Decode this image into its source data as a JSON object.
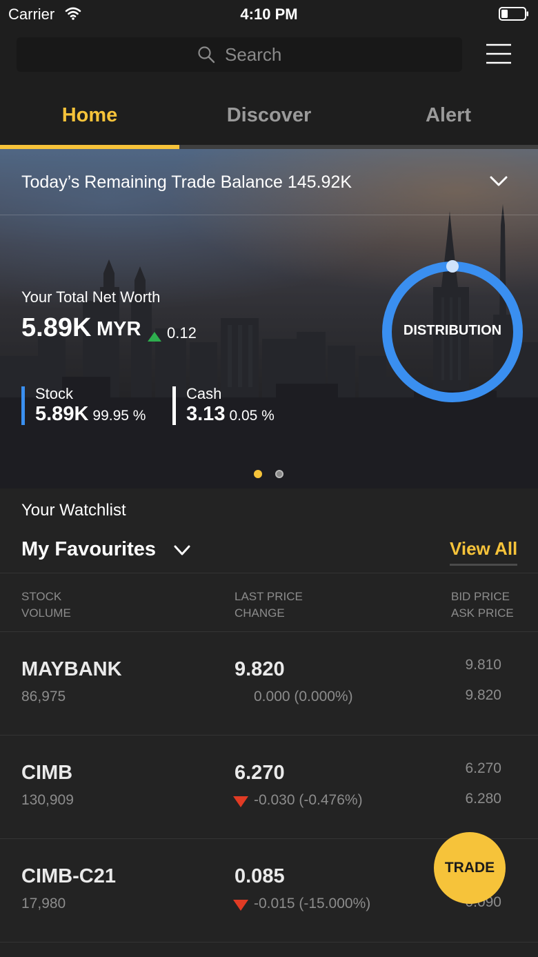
{
  "status_bar": {
    "carrier": "Carrier",
    "time": "4:10 PM"
  },
  "search": {
    "placeholder": "Search"
  },
  "tabs": [
    {
      "label": "Home",
      "active": true
    },
    {
      "label": "Discover",
      "active": false
    },
    {
      "label": "Alert",
      "active": false
    }
  ],
  "hero": {
    "balance_text": "Today’s Remaining Trade Balance 145.92K",
    "net_worth_label": "Your Total Net Worth",
    "net_worth_value": "5.89K",
    "net_worth_currency": "MYR",
    "net_worth_change": "0.12",
    "allocations": [
      {
        "label": "Stock",
        "value": "5.89K",
        "percent": "99.95 %"
      },
      {
        "label": "Cash",
        "value": "3.13",
        "percent": "0.05 %"
      }
    ],
    "distribution_label": "DISTRIBUTION",
    "page_index": 1,
    "page_count": 2
  },
  "watchlist": {
    "title": "Your Watchlist",
    "list_name": "My Favourites",
    "view_all": "View All",
    "headers": {
      "col1_line1": "STOCK",
      "col1_line2": "VOLUME",
      "col2_line1": "LAST PRICE",
      "col2_line2": "CHANGE",
      "col3_line1": "BID PRICE",
      "col3_line2": "ASK PRICE"
    },
    "rows": [
      {
        "stock": "MAYBANK",
        "volume": "86,975",
        "last_price": "9.820",
        "change": "0.000 (0.000%)",
        "direction": "flat",
        "bid": "9.810",
        "ask": "9.820"
      },
      {
        "stock": "CIMB",
        "volume": "130,909",
        "last_price": "6.270",
        "change": "-0.030 (-0.476%)",
        "direction": "down",
        "bid": "6.270",
        "ask": "6.280"
      },
      {
        "stock": "CIMB-C21",
        "volume": "17,980",
        "last_price": "0.085",
        "change": "-0.015 (-15.000%)",
        "direction": "down",
        "bid": "",
        "ask": "0.090"
      }
    ]
  },
  "trade_button": {
    "label": "TRADE"
  },
  "colors": {
    "accent": "#f6c33a",
    "ring": "#3a8ff0",
    "up": "#2eae4e",
    "down": "#e03b24",
    "background": "#232323"
  }
}
